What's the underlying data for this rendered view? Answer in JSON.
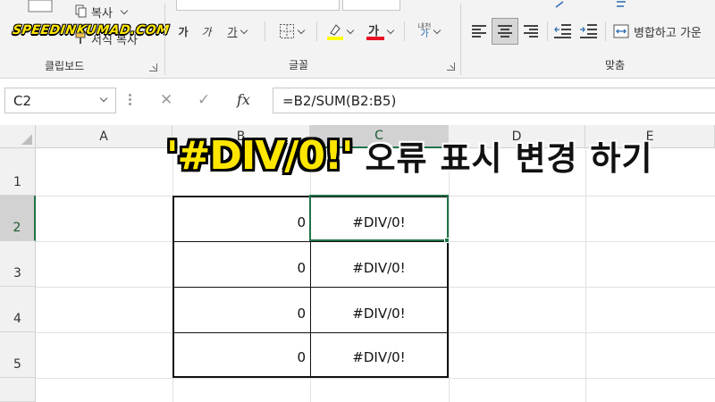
{
  "brand": "SPEEDINKUMAD.COM",
  "ribbon": {
    "clipboard": {
      "label": "클립보드",
      "copy_label": "복사",
      "format_painter_label": "서식 복사"
    },
    "font": {
      "label": "글꼴",
      "bold": "가",
      "italic": "가",
      "underline": "가",
      "font_color_glyph": "가",
      "phonetic_top": "내천",
      "phonetic_bottom": "가"
    },
    "alignment": {
      "label": "맞춤",
      "merge_label": "병합하고 가운"
    }
  },
  "formula_bar": {
    "name_box": "C2",
    "cancel": "✕",
    "enter": "✓",
    "fx": "fx",
    "formula": "=B2/SUM(B2:B5)"
  },
  "sheet": {
    "columns": [
      "A",
      "B",
      "C",
      "D",
      "E"
    ],
    "rows": [
      "1",
      "2",
      "3",
      "4",
      "5"
    ],
    "cells": {
      "B2": "0",
      "C2": "#DIV/0!",
      "B3": "0",
      "C3": "#DIV/0!",
      "B4": "0",
      "C4": "#DIV/0!",
      "B5": "0",
      "C5": "#DIV/0!"
    },
    "active_cell": "C2"
  },
  "overlay": {
    "main": "'#DIV/0!'",
    "sub": "오류 표시 변경 하기"
  },
  "colors": {
    "accent": "#217346",
    "banner_yellow": "#ffe600",
    "font_color_bar": "#e81123",
    "highlight_bar": "#ffff00",
    "table_border": "#111111"
  },
  "icons": [
    "copy-icon",
    "format-painter-icon",
    "border-icon",
    "highlight-icon",
    "font-color-icon",
    "phonetic-icon",
    "align-left-icon",
    "align-center-icon",
    "align-right-icon",
    "decrease-indent-icon",
    "increase-indent-icon",
    "merge-center-icon",
    "cancel-icon",
    "enter-icon",
    "fx-icon"
  ]
}
